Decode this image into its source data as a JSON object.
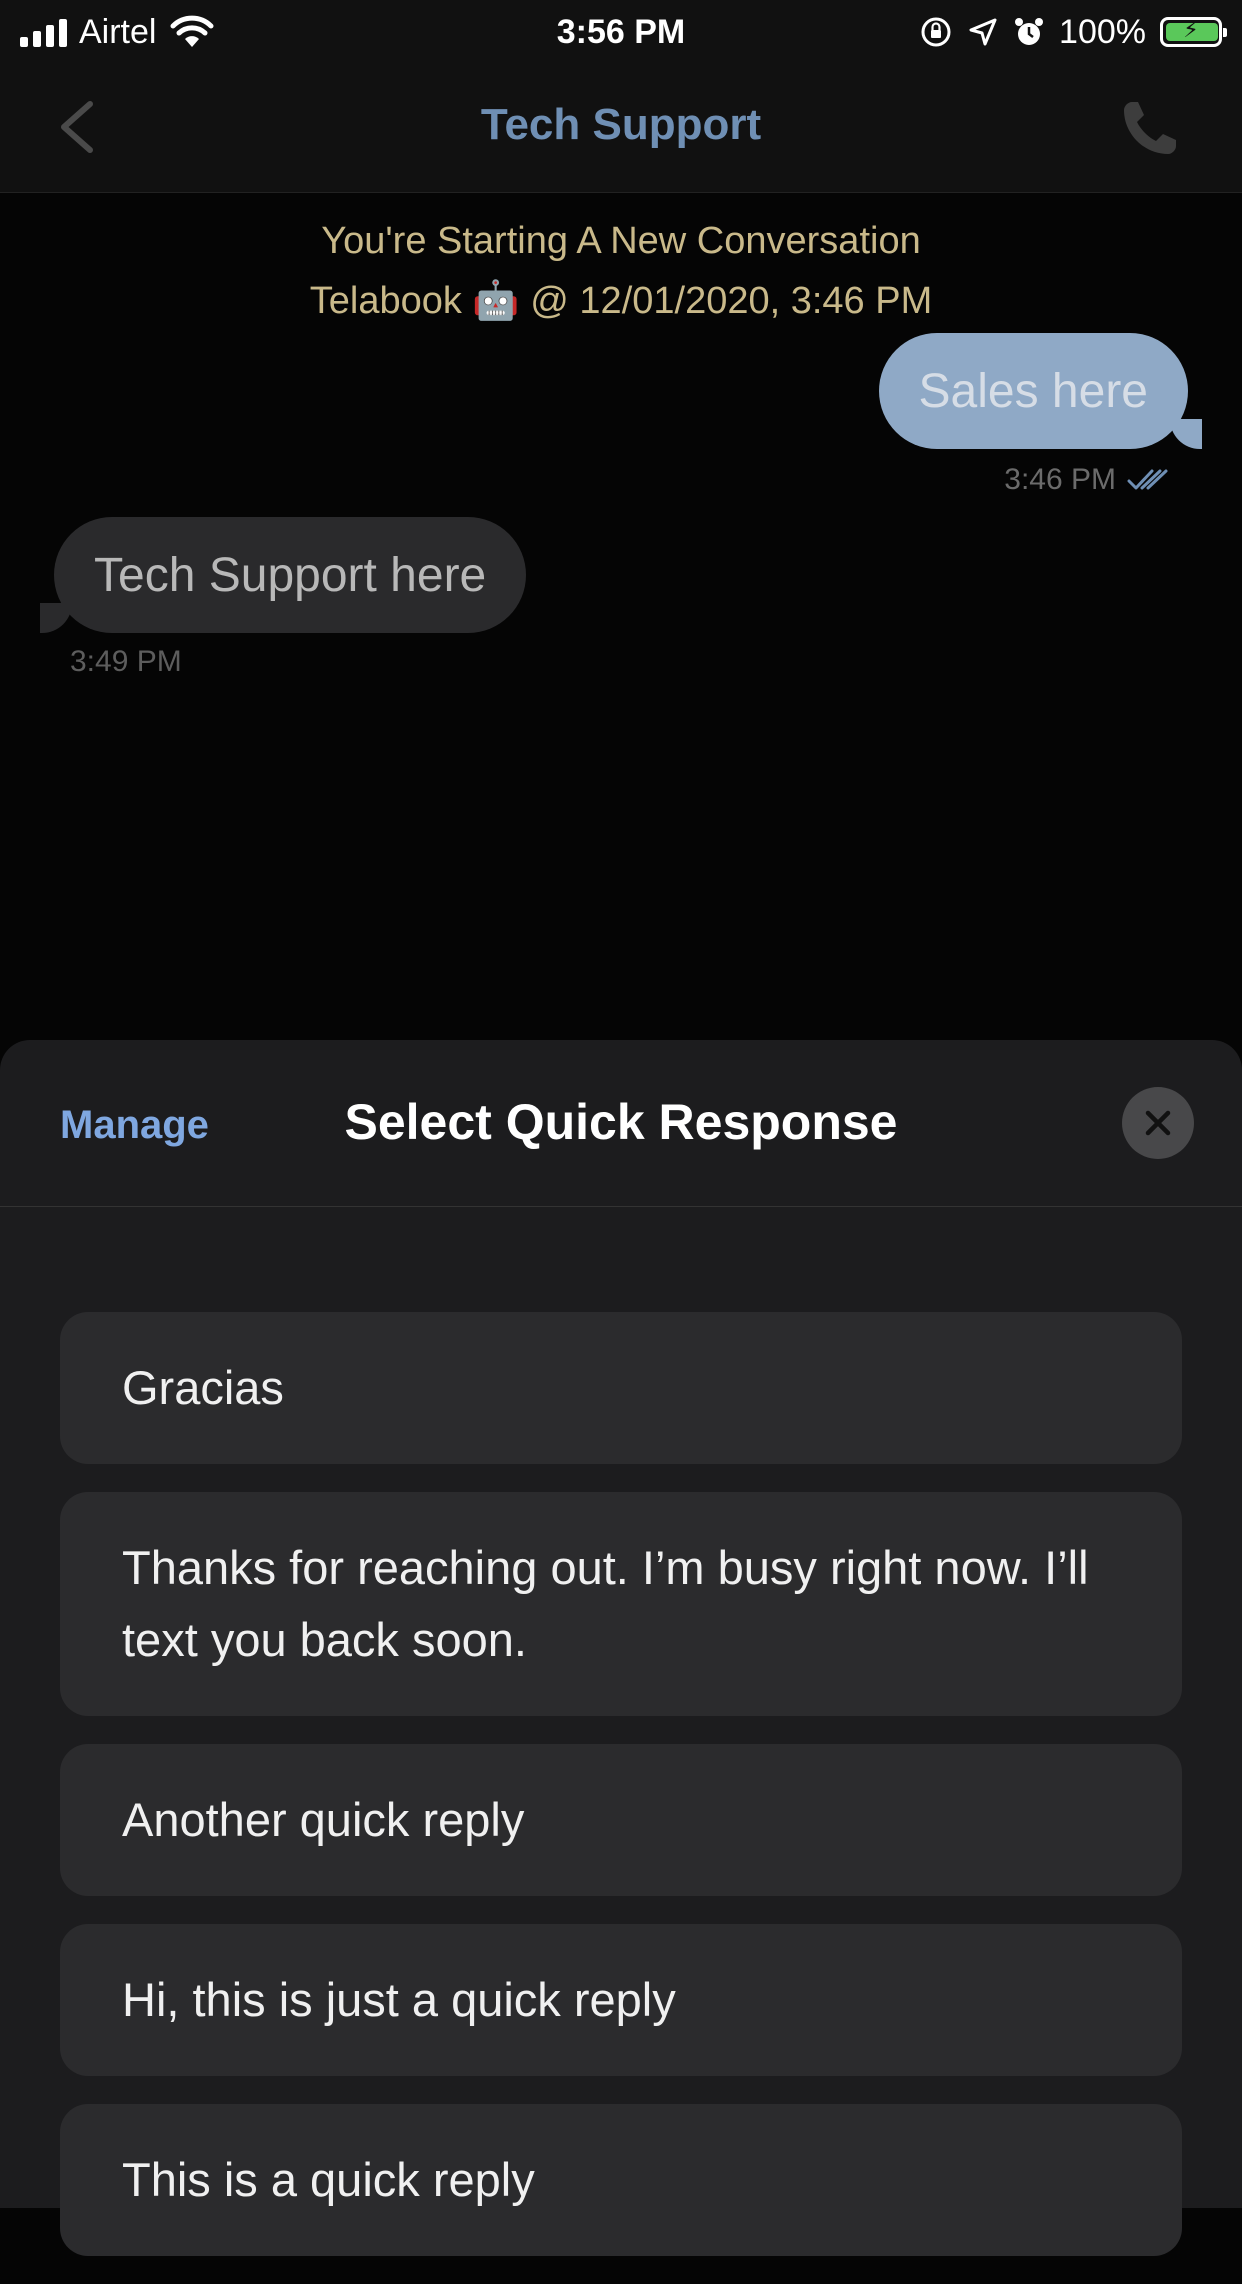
{
  "status_bar": {
    "carrier": "Airtel",
    "time": "3:56 PM",
    "battery": "100%"
  },
  "nav": {
    "title": "Tech Support",
    "back_icon": "chevron-left-icon",
    "call_icon": "phone-icon"
  },
  "chat": {
    "conversation_start": "You're Starting A New Conversation",
    "conversation_meta": "Telabook 🤖 @ 12/01/2020, 3:46 PM",
    "messages": [
      {
        "direction": "outgoing",
        "text": "Sales here",
        "time": "3:46 PM"
      },
      {
        "direction": "incoming",
        "text": "Tech Support here",
        "time": "3:49 PM"
      }
    ]
  },
  "quick_response_sheet": {
    "manage_label": "Manage",
    "title": "Select Quick Response",
    "close_icon": "close-icon",
    "items": [
      "Gracias",
      "Thanks for reaching out. I’m busy right now. I’ll text you back soon.",
      "Another quick reply",
      "Hi, this is just a quick reply",
      "This is a quick reply"
    ]
  },
  "colors": {
    "accent": "#6f8fb4",
    "manage": "#7fa7e0",
    "outgoing_bubble": "#8fa9c6",
    "incoming_bubble": "#2a2a2c",
    "system_text": "#c9b98a"
  }
}
